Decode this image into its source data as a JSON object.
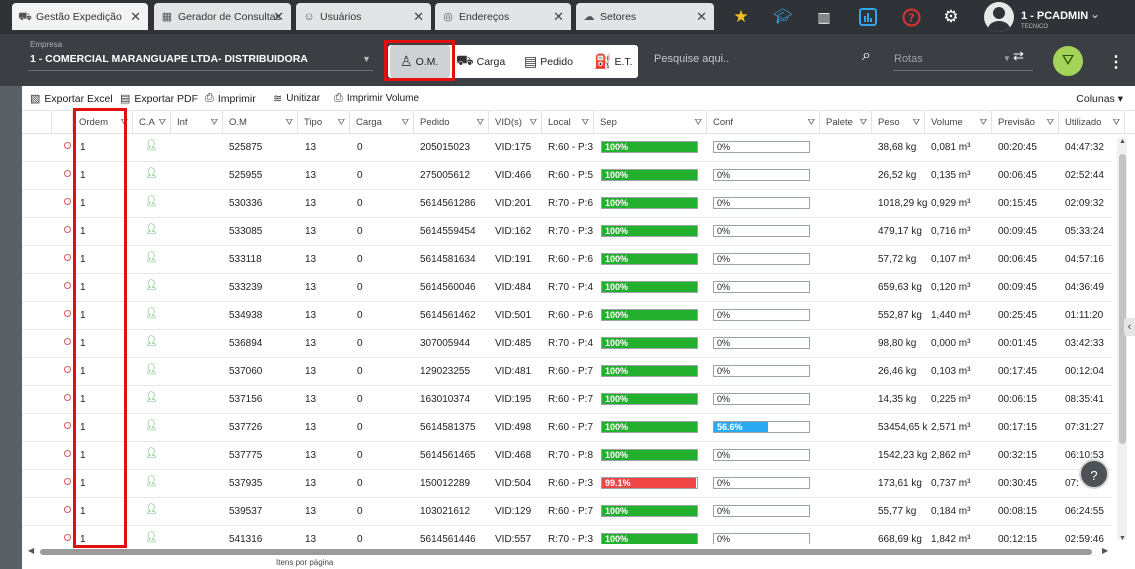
{
  "tabs": [
    {
      "label": "Gestão Expedição",
      "icon": "truck-icon"
    },
    {
      "label": "Gerador de Consultas",
      "icon": "table-icon"
    },
    {
      "label": "Usuários",
      "icon": "user-icon"
    },
    {
      "label": "Endereços",
      "icon": "compass-icon"
    },
    {
      "label": "Setores",
      "icon": "cloud-icon"
    }
  ],
  "top_icons": [
    "star-icon",
    "graduation-cap-icon",
    "map-icon",
    "bar-chart-icon",
    "help-circle-icon",
    "gear-icon"
  ],
  "user": {
    "name": "1 - PCADMIN",
    "role": "TECNICO"
  },
  "empresa": {
    "label": "Empresa",
    "value": "1 - COMERCIAL MARANGUAPE LTDA- DISTRIBUIDORA"
  },
  "view_buttons": [
    {
      "label": "O.M.",
      "active": true
    },
    {
      "label": "Carga",
      "active": false
    },
    {
      "label": "Pedido",
      "active": false
    },
    {
      "label": "E.T.",
      "active": false
    }
  ],
  "search": {
    "placeholder": "Pesquise aqui.."
  },
  "rotas": {
    "placeholder": "Rotas"
  },
  "toolbar": {
    "export_excel": "Exportar Excel",
    "export_pdf": "Exportar PDF",
    "imprimir": "Imprimir",
    "unitizar": "Unitizar",
    "imprimir_volume": "Imprimir Volume",
    "colunas": "Colunas"
  },
  "columns": [
    "Ordem",
    "C.A",
    "Inf",
    "O.M",
    "Tipo",
    "Carga",
    "Pedido",
    "VID(s)",
    "Local",
    "Sep",
    "Conf",
    "Palete",
    "Peso",
    "Volume",
    "Previsão",
    "Utilizado"
  ],
  "rows": [
    {
      "ordem": "1",
      "om": "525875",
      "tipo": "13",
      "carga": "0",
      "pedido": "205015023",
      "vid": "VID:175",
      "local": "R:60 - P:3",
      "sep": "100%",
      "sep_pct": 100,
      "conf": "0%",
      "conf_pct": 0,
      "peso": "38,68 kg",
      "volume": "0,081 m³",
      "previsao": "00:20:45",
      "utilizado": "04:47:32"
    },
    {
      "ordem": "1",
      "om": "525955",
      "tipo": "13",
      "carga": "0",
      "pedido": "275005612",
      "vid": "VID:466",
      "local": "R:60 - P:5",
      "sep": "100%",
      "sep_pct": 100,
      "conf": "0%",
      "conf_pct": 0,
      "peso": "26,52 kg",
      "volume": "0,135 m³",
      "previsao": "00:06:45",
      "utilizado": "02:52:44"
    },
    {
      "ordem": "1",
      "om": "530336",
      "tipo": "13",
      "carga": "0",
      "pedido": "5614561286",
      "vid": "VID:201",
      "local": "R:70 - P:6",
      "sep": "100%",
      "sep_pct": 100,
      "conf": "0%",
      "conf_pct": 0,
      "peso": "1018,29 kg",
      "volume": "0,929 m³",
      "previsao": "00:15:45",
      "utilizado": "02:09:32"
    },
    {
      "ordem": "1",
      "om": "533085",
      "tipo": "13",
      "carga": "0",
      "pedido": "5614559454",
      "vid": "VID:162",
      "local": "R:70 - P:3",
      "sep": "100%",
      "sep_pct": 100,
      "conf": "0%",
      "conf_pct": 0,
      "peso": "479,17 kg",
      "volume": "0,716 m³",
      "previsao": "00:09:45",
      "utilizado": "05:33:24"
    },
    {
      "ordem": "1",
      "om": "533118",
      "tipo": "13",
      "carga": "0",
      "pedido": "5614581634",
      "vid": "VID:191",
      "local": "R:60 - P:6",
      "sep": "100%",
      "sep_pct": 100,
      "conf": "0%",
      "conf_pct": 0,
      "peso": "57,72 kg",
      "volume": "0,107 m³",
      "previsao": "00:06:45",
      "utilizado": "04:57:16"
    },
    {
      "ordem": "1",
      "om": "533239",
      "tipo": "13",
      "carga": "0",
      "pedido": "5614560046",
      "vid": "VID:484",
      "local": "R:70 - P:4",
      "sep": "100%",
      "sep_pct": 100,
      "conf": "0%",
      "conf_pct": 0,
      "peso": "659,63 kg",
      "volume": "0,120 m³",
      "previsao": "00:09:45",
      "utilizado": "04:36:49"
    },
    {
      "ordem": "1",
      "om": "534938",
      "tipo": "13",
      "carga": "0",
      "pedido": "5614561462",
      "vid": "VID:501",
      "local": "R:60 - P:6",
      "sep": "100%",
      "sep_pct": 100,
      "conf": "0%",
      "conf_pct": 0,
      "peso": "552,87 kg",
      "volume": "1,440 m³",
      "previsao": "00:25:45",
      "utilizado": "01:11:20"
    },
    {
      "ordem": "1",
      "om": "536894",
      "tipo": "13",
      "carga": "0",
      "pedido": "307005944",
      "vid": "VID:485",
      "local": "R:70 - P:4",
      "sep": "100%",
      "sep_pct": 100,
      "conf": "0%",
      "conf_pct": 0,
      "peso": "98,80 kg",
      "volume": "0,000 m³",
      "previsao": "00:01:45",
      "utilizado": "03:42:33"
    },
    {
      "ordem": "1",
      "om": "537060",
      "tipo": "13",
      "carga": "0",
      "pedido": "129023255",
      "vid": "VID:481",
      "local": "R:60 - P:7",
      "sep": "100%",
      "sep_pct": 100,
      "conf": "0%",
      "conf_pct": 0,
      "peso": "26,46 kg",
      "volume": "0,103 m³",
      "previsao": "00:17:45",
      "utilizado": "00:12:04"
    },
    {
      "ordem": "1",
      "om": "537156",
      "tipo": "13",
      "carga": "0",
      "pedido": "163010374",
      "vid": "VID:195",
      "local": "R:60 - P:7",
      "sep": "100%",
      "sep_pct": 100,
      "conf": "0%",
      "conf_pct": 0,
      "peso": "14,35 kg",
      "volume": "0,225 m³",
      "previsao": "00:06:15",
      "utilizado": "08:35:41"
    },
    {
      "ordem": "1",
      "om": "537726",
      "tipo": "13",
      "carga": "0",
      "pedido": "5614581375",
      "vid": "VID:498",
      "local": "R:60 - P:7",
      "sep": "100%",
      "sep_pct": 100,
      "conf": "56.6%",
      "conf_pct": 56.6,
      "peso": "53454,65 k",
      "volume": "2,571 m³",
      "previsao": "00:17:15",
      "utilizado": "07:31:27"
    },
    {
      "ordem": "1",
      "om": "537775",
      "tipo": "13",
      "carga": "0",
      "pedido": "5614561465",
      "vid": "VID:468",
      "local": "R:70 - P:8",
      "sep": "100%",
      "sep_pct": 100,
      "conf": "0%",
      "conf_pct": 0,
      "peso": "1542,23 kg",
      "volume": "2,862 m³",
      "previsao": "00:32:15",
      "utilizado": "06:10:53"
    },
    {
      "ordem": "1",
      "om": "537935",
      "tipo": "13",
      "carga": "0",
      "pedido": "150012289",
      "vid": "VID:504",
      "local": "R:60 - P:3",
      "sep": "99.1%",
      "sep_pct": 99.1,
      "conf": "0%",
      "conf_pct": 0,
      "peso": "173,61 kg",
      "volume": "0,737 m³",
      "previsao": "00:30:45",
      "utilizado": "07:"
    },
    {
      "ordem": "1",
      "om": "539537",
      "tipo": "13",
      "carga": "0",
      "pedido": "103021612",
      "vid": "VID:129",
      "local": "R:60 - P:7",
      "sep": "100%",
      "sep_pct": 100,
      "conf": "0%",
      "conf_pct": 0,
      "peso": "55,77 kg",
      "volume": "0,184 m³",
      "previsao": "00:08:15",
      "utilizado": "06:24:55"
    },
    {
      "ordem": "1",
      "om": "541316",
      "tipo": "13",
      "carga": "0",
      "pedido": "5614561446",
      "vid": "VID:557",
      "local": "R:70 - P:3",
      "sep": "100%",
      "sep_pct": 100,
      "conf": "0%",
      "conf_pct": 0,
      "peso": "668,69 kg",
      "volume": "1,842 m³",
      "previsao": "00:12:15",
      "utilizado": "02:59:46"
    }
  ],
  "footer": {
    "items_per_page": "Itens por página"
  },
  "colors": {
    "sep_full": "#22b02d",
    "sep_partial": "#ef4545",
    "conf_fill": "#29a9f0",
    "highlight": "#e01010",
    "accent": "#a4d35a"
  }
}
